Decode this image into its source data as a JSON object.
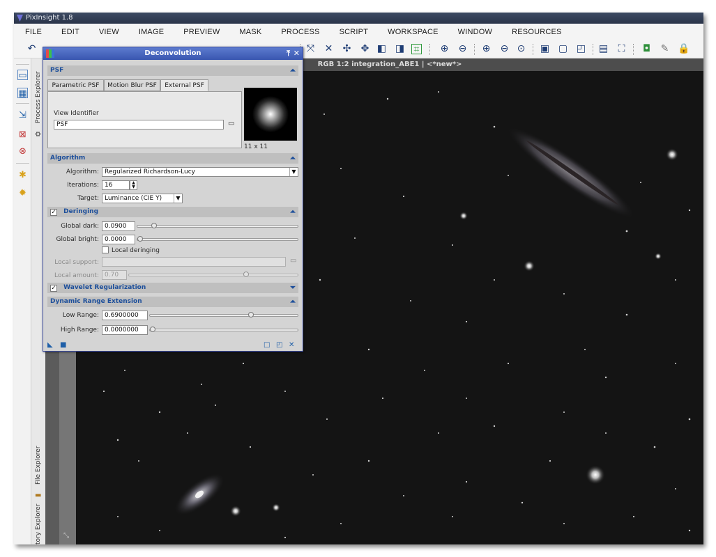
{
  "app": {
    "title": "PixInsight 1.8"
  },
  "menu": [
    "FILE",
    "EDIT",
    "VIEW",
    "IMAGE",
    "PREVIEW",
    "MASK",
    "PROCESS",
    "SCRIPT",
    "WORKSPACE",
    "WINDOW",
    "RESOURCES"
  ],
  "sidebar_tabs": {
    "process_explorer": "Process Explorer",
    "file_explorer": "File Explorer",
    "history_explorer": "History Explorer"
  },
  "image_window": {
    "title": "RGB 1:2 integration_ABE1 | <*new*>"
  },
  "dialog": {
    "title": "Deconvolution",
    "psf": {
      "section": "PSF",
      "tabs": [
        "Parametric PSF",
        "Motion Blur PSF",
        "External PSF"
      ],
      "active_tab": "External PSF",
      "view_identifier_label": "View Identifier",
      "view_identifier_value": "PSF",
      "thumb_caption": "11 x 11"
    },
    "algorithm": {
      "section": "Algorithm",
      "algorithm_label": "Algorithm:",
      "algorithm_value": "Regularized Richardson-Lucy",
      "iterations_label": "Iterations:",
      "iterations_value": "16",
      "target_label": "Target:",
      "target_value": "Luminance (CIE Y)"
    },
    "deringing": {
      "section": "Deringing",
      "enabled": true,
      "global_dark_label": "Global dark:",
      "global_dark_value": "0.0900",
      "global_dark": 0.09,
      "global_bright_label": "Global bright:",
      "global_bright_value": "0.0000",
      "global_bright": 0.0,
      "local_deringing_label": "Local deringing",
      "local_support_label": "Local support:",
      "local_support_value": "",
      "local_amount_label": "Local amount:",
      "local_amount_value": "0.70",
      "local_amount": 0.7
    },
    "wavelet": {
      "section": "Wavelet Regularization",
      "enabled": true
    },
    "dre": {
      "section": "Dynamic Range Extension",
      "low_label": "Low Range:",
      "low_value": "0.6900000",
      "low": 0.69,
      "high_label": "High Range:",
      "high_value": "0.0000000",
      "high": 0.0
    }
  },
  "colors": {
    "dialog_title": "#3956b0",
    "section_text": "#1d4f9b",
    "image_background": "#141414"
  }
}
